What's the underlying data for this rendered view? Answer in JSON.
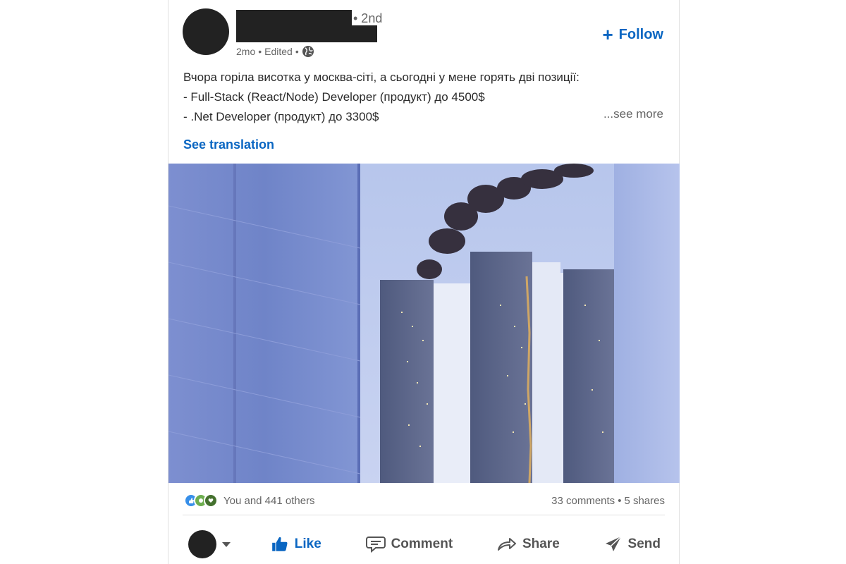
{
  "post": {
    "degree": "• 2nd",
    "time": "2mo",
    "edited": "Edited",
    "follow_label": "Follow",
    "follow_plus": "+",
    "text_lines": [
      "Вчора горіла висотка у москва-сіті, а сьогодні у мене горять дві позиції:",
      "- Full-Stack (React/Node) Developer (продукт) до 4500$",
      "- .Net Developer (продукт) до 3300$"
    ],
    "see_more": "...see more",
    "see_translation": "See translation"
  },
  "social": {
    "reactions_text": "You and 441 others",
    "comments": "33 comments",
    "separator": "•",
    "shares": "5 shares"
  },
  "actions": {
    "like": "Like",
    "comment": "Comment",
    "share": "Share",
    "send": "Send"
  },
  "colors": {
    "accent": "#0a66c2",
    "muted": "#666666",
    "text": "#2a2a2a"
  },
  "icons": [
    "globe-icon",
    "thumbs-up-icon",
    "comment-icon",
    "share-arrow-icon",
    "send-icon",
    "caret-down-icon"
  ]
}
